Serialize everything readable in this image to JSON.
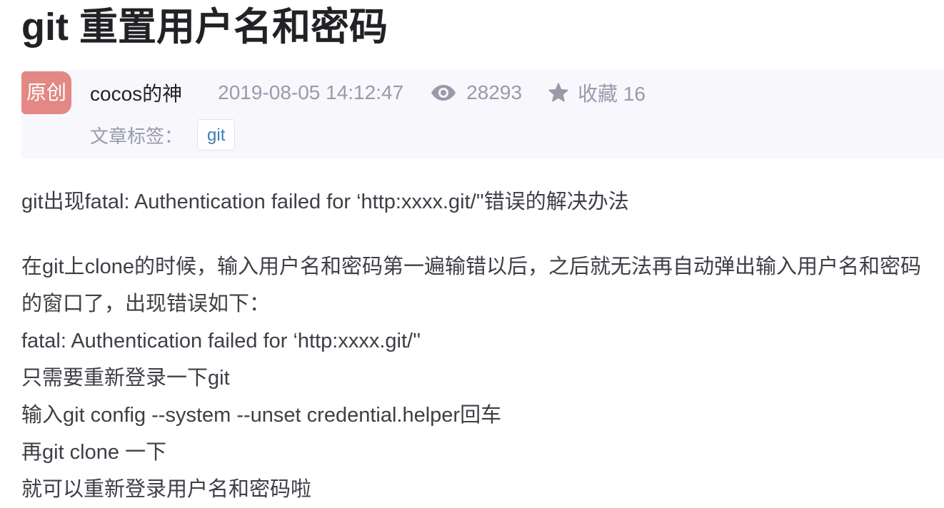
{
  "article": {
    "title": "git 重置用户名和密码",
    "badge": "原创",
    "author": "cocos的神",
    "datetime": "2019-08-05 14:12:47",
    "views": "28293",
    "favorite_label": "收藏 16",
    "tags_label": "文章标签：",
    "tags": [
      "git"
    ]
  },
  "icons": {
    "views": "eye-icon",
    "favorite": "star-icon"
  },
  "colors": {
    "badge_bg": "#e38884",
    "meta_text": "#999aaa",
    "tag_text": "#3d7eb5",
    "meta_bg": "#f7f7fc"
  },
  "content": {
    "intro": "git出现fatal: Authentication failed for ‘http:xxxx.git/''错误的解决办法",
    "lines": [
      "在git上clone的时候，输入用户名和密码第一遍输错以后，之后就无法再自动弹出输入用户名和密码",
      "的窗口了，出现错误如下：",
      "fatal: Authentication failed for ‘http:xxxx.git/''",
      "只需要重新登录一下git",
      "输入git config --system --unset credential.helper回车",
      "再git clone 一下",
      "就可以重新登录用户名和密码啦"
    ]
  }
}
